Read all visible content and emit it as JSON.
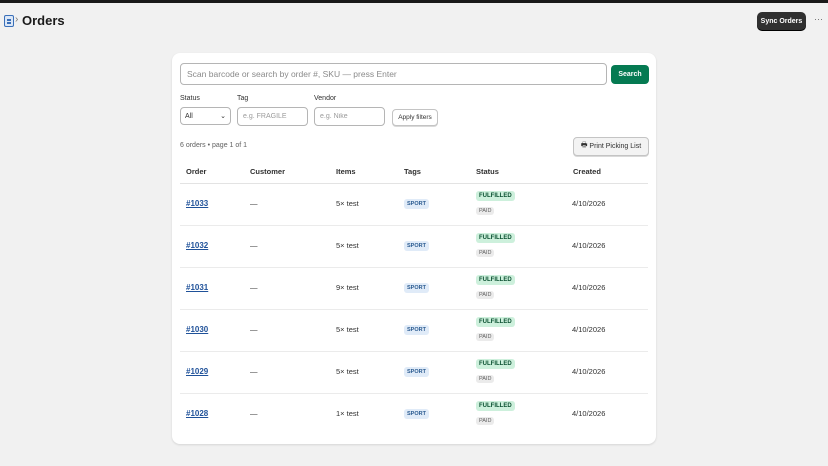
{
  "header": {
    "title": "Orders",
    "sync_label": "Sync Orders",
    "more_label": "···"
  },
  "search": {
    "placeholder": "Scan barcode or search by order #, SKU — press Enter",
    "button_label": "Search"
  },
  "filters": {
    "status_label": "Status",
    "status_value": "All",
    "tag_label": "Tag",
    "tag_placeholder": "e.g. FRAGILE",
    "vendor_label": "Vendor",
    "vendor_placeholder": "e.g. Nike",
    "apply_label": "Apply filters"
  },
  "summary": "6 orders • page 1 of 1",
  "print_label": "Print Picking List",
  "table": {
    "columns": [
      "Order",
      "Customer",
      "Items",
      "Tags",
      "Status",
      "Created"
    ],
    "rows": [
      {
        "order": "#1033",
        "customer": "—",
        "items": "5× test",
        "tag": "SPORT",
        "fulfillment": "FULFILLED",
        "payment": "PAID",
        "created": "4/10/2026"
      },
      {
        "order": "#1032",
        "customer": "—",
        "items": "5× test",
        "tag": "SPORT",
        "fulfillment": "FULFILLED",
        "payment": "PAID",
        "created": "4/10/2026"
      },
      {
        "order": "#1031",
        "customer": "—",
        "items": "9× test",
        "tag": "SPORT",
        "fulfillment": "FULFILLED",
        "payment": "PAID",
        "created": "4/10/2026"
      },
      {
        "order": "#1030",
        "customer": "—",
        "items": "5× test",
        "tag": "SPORT",
        "fulfillment": "FULFILLED",
        "payment": "PAID",
        "created": "4/10/2026"
      },
      {
        "order": "#1029",
        "customer": "—",
        "items": "5× test",
        "tag": "SPORT",
        "fulfillment": "FULFILLED",
        "payment": "PAID",
        "created": "4/10/2026"
      },
      {
        "order": "#1028",
        "customer": "—",
        "items": "1× test",
        "tag": "SPORT",
        "fulfillment": "FULFILLED",
        "payment": "PAID",
        "created": "4/10/2026"
      }
    ]
  },
  "icons": {
    "app": "orders-app-icon",
    "breadcrumb": "chevron-right-icon",
    "more": "more-horizontal-icon",
    "printer": "printer-icon",
    "select": "chevron-down-icon"
  },
  "colors": {
    "primary_button": "#057a52",
    "link": "#1f5199",
    "fulfilled_bg": "#cdf0dc",
    "tag_bg": "#e0ebf8",
    "dark_button": "#303030"
  }
}
